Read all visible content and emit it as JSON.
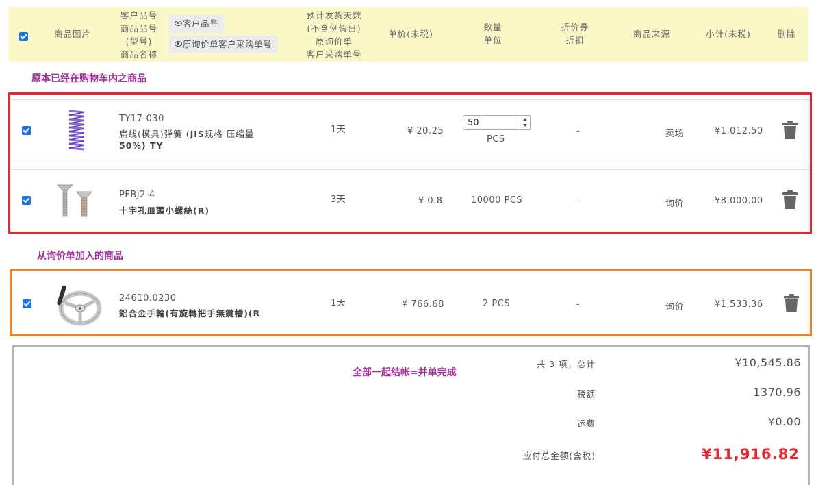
{
  "header": {
    "select_all_checked": true,
    "col_image": "商品图片",
    "col_part_lines": [
      "客户品号",
      "商品品号",
      "(型号)",
      "商品名称"
    ],
    "btn_customer_no": "客户品号",
    "btn_inquiry_no": "原询价单客户采购单号",
    "col_ship_lines": [
      "预计发货天数",
      "(不含例假日)",
      "原询价单",
      "客户采购单号"
    ],
    "col_unit_price": "单价(未税)",
    "col_qty_lines": [
      "数量",
      "单位"
    ],
    "col_coupon_lines": [
      "折价券",
      "折扣"
    ],
    "col_source": "商品来源",
    "col_subtotal": "小计(未税)",
    "col_delete": "删除"
  },
  "sections": {
    "cart_title": "原本已经在购物车内之商品",
    "inquiry_title": "从询价单加入的商品",
    "checkout_note": "全部一起结帐=并单完成"
  },
  "items": [
    {
      "code": "TY17-030",
      "name_line1": "扁线(模具)弹簧 (",
      "name_bold1": "JIS",
      "name_line1b": "规格 压缩量",
      "name_line2": "50%) TY",
      "ship_days": "1天",
      "unit_price": "¥ 20.25",
      "qty": "50",
      "unit": "PCS",
      "coupon": "-",
      "source": "卖场",
      "subtotal": "¥1,012.50"
    },
    {
      "code": "PFBJ2-4",
      "name_line1": "十字孔皿頭小螺絲(R)",
      "ship_days": "3天",
      "unit_price": "¥ 0.8",
      "qty_unit": "10000 PCS",
      "coupon": "-",
      "source": "询价",
      "subtotal": "¥8,000.00"
    },
    {
      "code": "24610.0230",
      "name_line1": "鋁合金手輪(有旋轉把手無鍵槽)(R",
      "ship_days": "1天",
      "unit_price": "¥ 766.68",
      "qty_unit": "2 PCS",
      "coupon": "-",
      "source": "询价",
      "subtotal": "¥1,533.36"
    }
  ],
  "summary": {
    "count_label": "共 3 项，总计",
    "count_value": "¥10,545.86",
    "tax_label": "税额",
    "tax_value": "1370.96",
    "shipping_label": "运费",
    "shipping_value": "¥0.00",
    "total_label": "应付总金额(含税)",
    "total_value": "¥11,916.82"
  },
  "colors": {
    "header_bg": "#fbf8c8",
    "cart_border": "#e0282e",
    "inquiry_border": "#f47e2a",
    "summary_border": "#b3b3b3",
    "section_title": "#a0309a",
    "total_price": "#e0282e",
    "checkbox": "#1a73e8"
  }
}
